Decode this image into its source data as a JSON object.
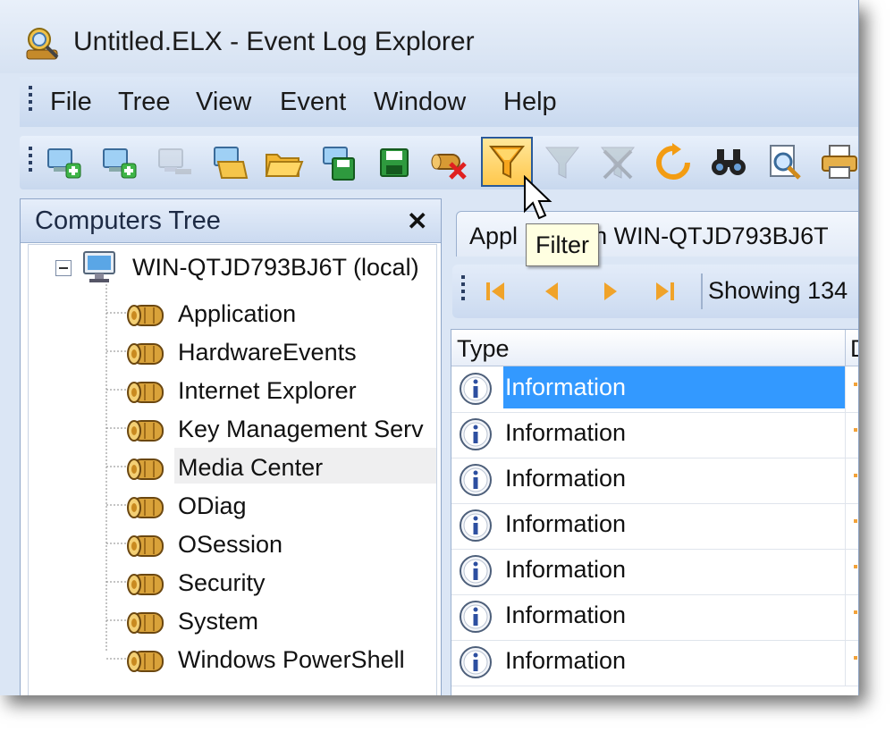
{
  "window": {
    "title": "Untitled.ELX - Event Log Explorer"
  },
  "menu": {
    "items": [
      "File",
      "Tree",
      "View",
      "Event",
      "Window",
      "Help"
    ]
  },
  "toolbar": {
    "buttons": [
      {
        "icon": "new-computer-icon",
        "enabled": true
      },
      {
        "icon": "add-computer-icon",
        "enabled": true
      },
      {
        "icon": "remove-computer-icon",
        "enabled": false
      },
      {
        "icon": "open-workspace-icon",
        "enabled": true
      },
      {
        "icon": "open-folder-icon",
        "enabled": true
      },
      {
        "icon": "save-workspace-icon",
        "enabled": true
      },
      {
        "icon": "save-icon",
        "enabled": true
      },
      {
        "icon": "clear-log-icon",
        "enabled": true
      },
      {
        "icon": "filter-icon",
        "enabled": true,
        "active": true
      },
      {
        "icon": "quick-filter-icon",
        "enabled": false
      },
      {
        "icon": "reset-filter-icon",
        "enabled": false
      },
      {
        "icon": "refresh-icon",
        "enabled": true
      },
      {
        "icon": "find-icon",
        "enabled": true
      },
      {
        "icon": "preview-icon",
        "enabled": true
      },
      {
        "icon": "print-icon",
        "enabled": true
      }
    ],
    "tooltip": "Filter"
  },
  "computers_tree": {
    "title": "Computers Tree",
    "close_label": "✕",
    "computer": "WIN-QTJD793BJ6T (local)",
    "logs": [
      "Application",
      "HardwareEvents",
      "Internet Explorer",
      "Key Management Serv",
      "Media Center",
      "ODiag",
      "OSession",
      "Security",
      "System",
      "Windows PowerShell"
    ],
    "hovered_index": 3
  },
  "log_view": {
    "tab_prefix": "Appl",
    "tab_suffix": "on WIN-QTJD793BJ6T",
    "showing_text": "Showing 134",
    "columns": [
      "Type",
      "D"
    ],
    "rows": [
      "Information",
      "Information",
      "Information",
      "Information",
      "Information",
      "Information",
      "Information"
    ],
    "selected_index": 0
  },
  "colors": {
    "selection": "#3399ff",
    "tooltip_bg": "#ffffe1",
    "active_button": "#ffc84d"
  }
}
